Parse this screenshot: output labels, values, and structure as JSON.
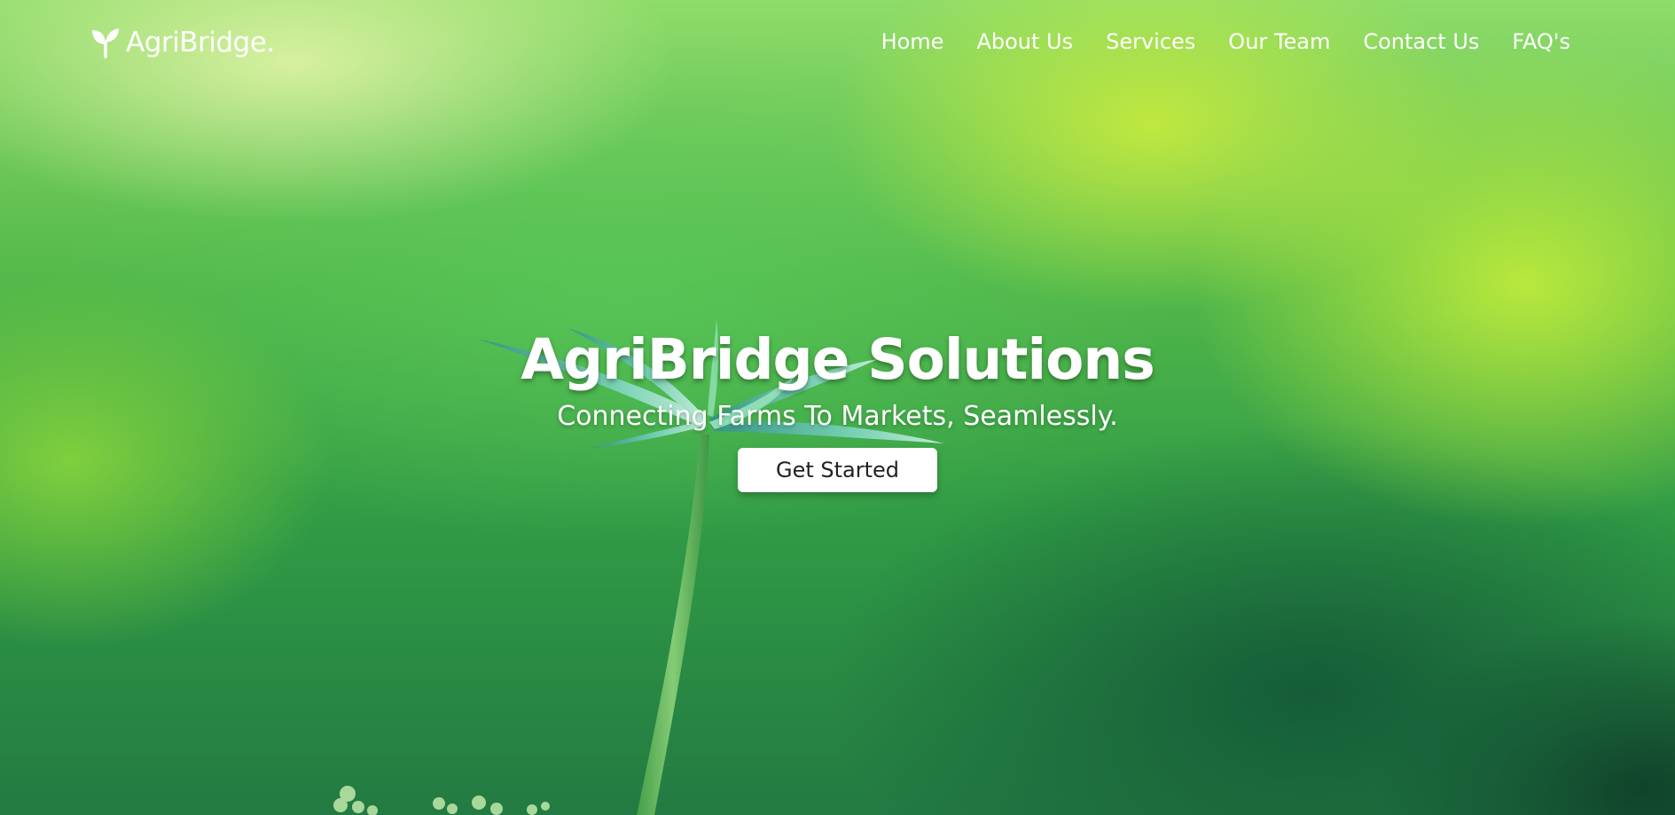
{
  "brand": {
    "icon": "sprout-icon",
    "name": "AgriBridge."
  },
  "nav": {
    "links": [
      "Home",
      "About Us",
      "Services",
      "Our Team",
      "Contact Us",
      "FAQ's"
    ]
  },
  "hero": {
    "title": "AgriBridge Solutions",
    "subtitle": "Connecting Farms To Markets, Seamlessly.",
    "cta_label": "Get Started"
  },
  "colors": {
    "primary_green": "#3aa548",
    "light_green": "#c8ec4c",
    "dark_green": "#1a5a3a",
    "text": "#ffffff",
    "button_bg": "#ffffff",
    "button_text": "#222222"
  }
}
